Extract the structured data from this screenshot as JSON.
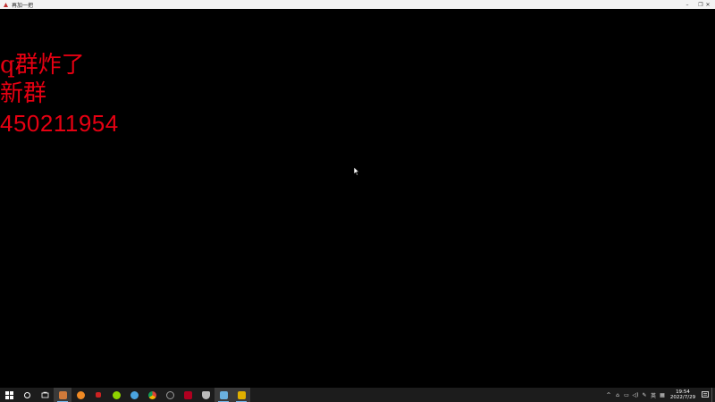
{
  "window": {
    "title": "再加一把",
    "controls": {
      "minimize": "–",
      "restore": "❐",
      "close": "✕"
    }
  },
  "content": {
    "lines": [
      "q群炸了",
      "新群",
      "450211954"
    ],
    "text_color": "#e60012",
    "background": "#000000"
  },
  "taskbar": {
    "apps": [
      {
        "name": "start-icon",
        "color": "#ffffff"
      },
      {
        "name": "search-icon",
        "color": "#ffffff"
      },
      {
        "name": "task-view-icon",
        "color": "#ffffff"
      },
      {
        "name": "app-1-icon",
        "color": "#d17a3a",
        "active": true
      },
      {
        "name": "app-2-icon",
        "color": "#f08a24"
      },
      {
        "name": "app-3-icon",
        "color": "#cc2222"
      },
      {
        "name": "app-4-icon",
        "color": "#8fd400"
      },
      {
        "name": "steam-icon",
        "color": "#4aa3df"
      },
      {
        "name": "chrome-icon",
        "color": "#3fa34d"
      },
      {
        "name": "app-5-icon",
        "color": "#999999"
      },
      {
        "name": "app-6-icon",
        "color": "#b00020"
      },
      {
        "name": "app-7-icon",
        "color": "#bbbbbb"
      },
      {
        "name": "app-8-icon",
        "color": "#6ab0de",
        "active": true
      },
      {
        "name": "app-9-icon",
        "color": "#e0b000",
        "active": true
      }
    ],
    "tray": {
      "icons": [
        "^",
        "⌂",
        "▭",
        "◁)",
        "✎",
        "英",
        "▦"
      ],
      "time": "19:54",
      "date": "2022/7/29"
    }
  }
}
